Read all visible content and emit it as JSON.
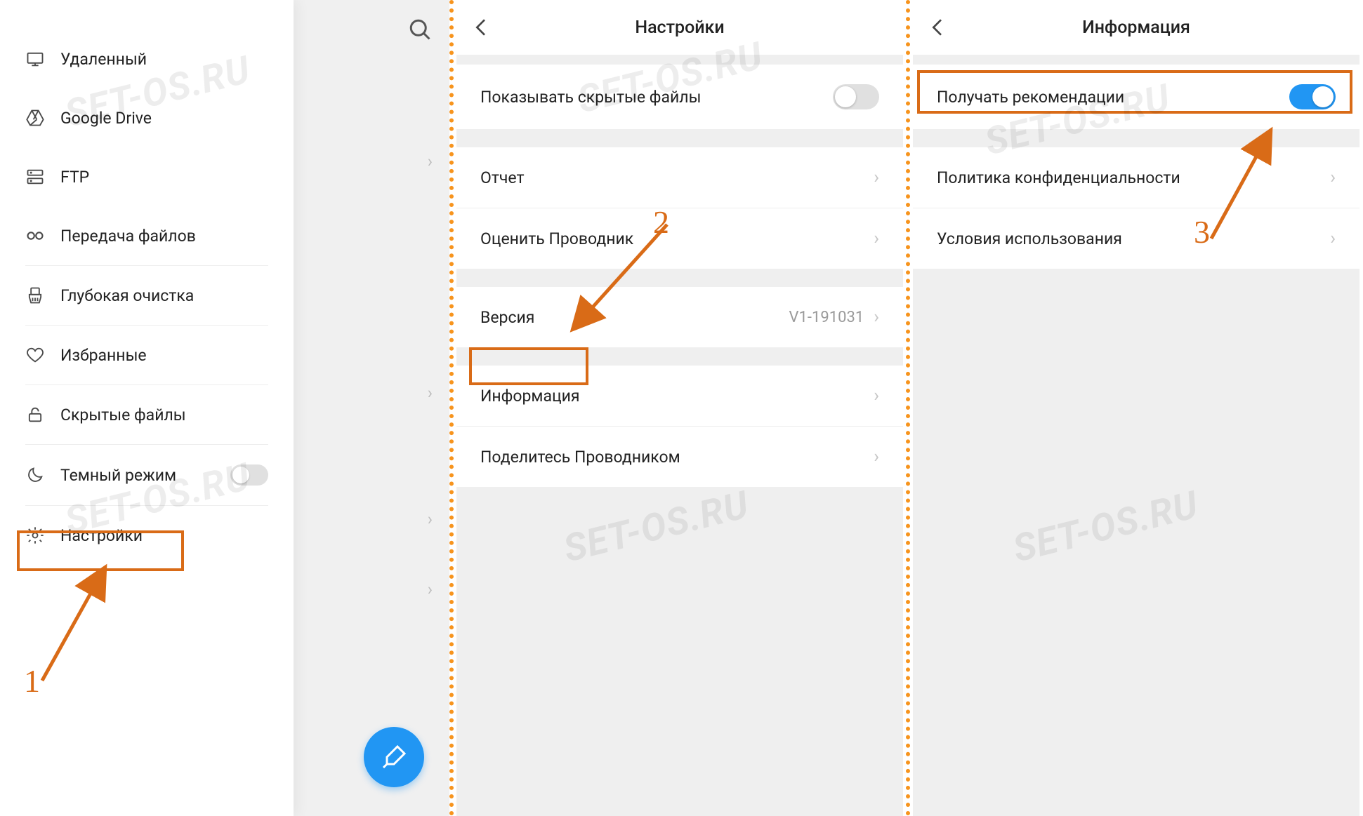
{
  "watermark_text": "SET-OS.RU",
  "panel1": {
    "drawer_items": [
      {
        "icon": "remote-icon",
        "label": "Удаленный"
      },
      {
        "icon": "gdrive-icon",
        "label": "Google Drive"
      },
      {
        "icon": "ftp-icon",
        "label": "FTP"
      },
      {
        "icon": "transfer-icon",
        "label": "Передача файлов"
      },
      {
        "icon": "clean-icon",
        "label": "Глубокая очистка"
      },
      {
        "icon": "heart-icon",
        "label": "Избранные"
      },
      {
        "icon": "lock-icon",
        "label": "Скрытые файлы"
      },
      {
        "icon": "moon-icon",
        "label": "Темный режим",
        "has_toggle": true,
        "toggle_on": false
      },
      {
        "icon": "gear-icon",
        "label": "Настройки",
        "highlighted": true
      }
    ]
  },
  "panel2": {
    "title": "Настройки",
    "sections": [
      {
        "rows": [
          {
            "label": "Показывать скрытые файлы",
            "type": "toggle",
            "on": false
          }
        ]
      },
      {
        "rows": [
          {
            "label": "Отчет",
            "type": "link"
          },
          {
            "label": "Оценить Проводник",
            "type": "link"
          }
        ]
      },
      {
        "rows": [
          {
            "label": "Версия",
            "type": "value",
            "value": "V1-191031"
          }
        ]
      },
      {
        "rows": [
          {
            "label": "Информация",
            "type": "link",
            "highlighted": true
          },
          {
            "label": "Поделитесь Проводником",
            "type": "link"
          }
        ]
      }
    ]
  },
  "panel3": {
    "title": "Информация",
    "sections": [
      {
        "rows": [
          {
            "label": "Получать рекомендации",
            "type": "toggle",
            "on": true,
            "highlighted": true
          }
        ]
      },
      {
        "rows": [
          {
            "label": "Политика конфиденциальности",
            "type": "link"
          },
          {
            "label": "Условия использования",
            "type": "link"
          }
        ]
      }
    ]
  },
  "steps": {
    "one": "1",
    "two": "2",
    "three": "3"
  }
}
